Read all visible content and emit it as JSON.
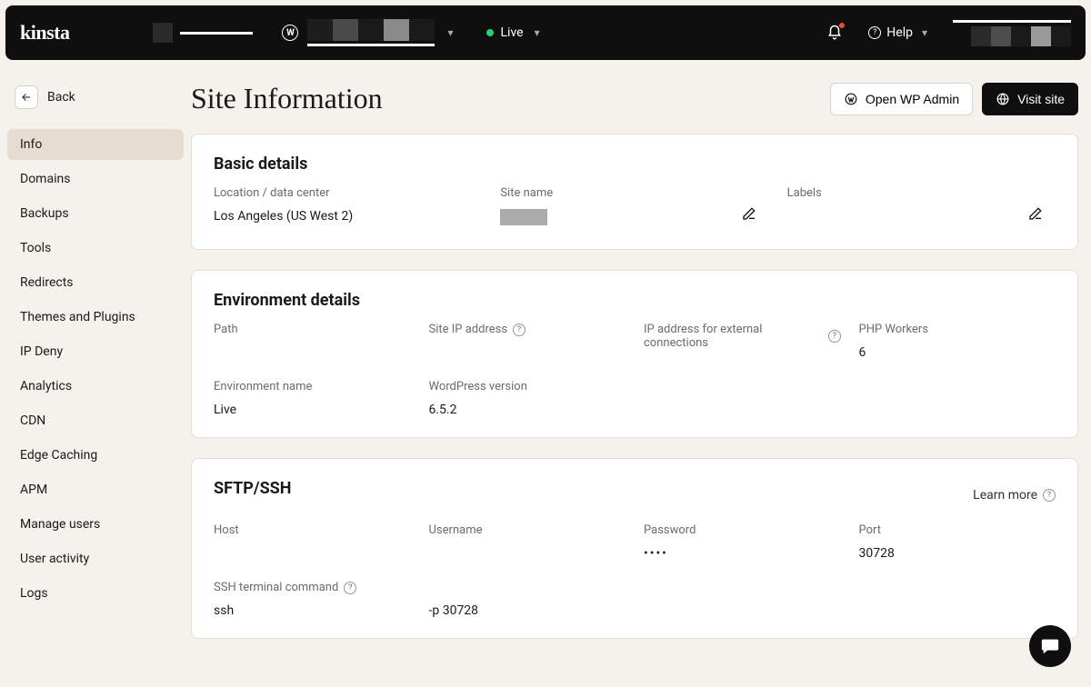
{
  "topbar": {
    "logo": "kinsta",
    "env_label": "Live",
    "help_label": "Help"
  },
  "sidebar": {
    "back_label": "Back",
    "items": [
      "Info",
      "Domains",
      "Backups",
      "Tools",
      "Redirects",
      "Themes and Plugins",
      "IP Deny",
      "Analytics",
      "CDN",
      "Edge Caching",
      "APM",
      "Manage users",
      "User activity",
      "Logs"
    ],
    "active_index": 0
  },
  "header": {
    "title": "Site Information",
    "open_wp_admin": "Open WP Admin",
    "visit_site": "Visit site"
  },
  "basic": {
    "heading": "Basic details",
    "location_label": "Location / data center",
    "location_value": "Los Angeles (US West 2)",
    "site_name_label": "Site name",
    "labels_label": "Labels"
  },
  "env": {
    "heading": "Environment details",
    "path_label": "Path",
    "site_ip_label": "Site IP address",
    "ext_ip_label": "IP address for external connections",
    "php_workers_label": "PHP Workers",
    "php_workers_value": "6",
    "env_name_label": "Environment name",
    "env_name_value": "Live",
    "wp_version_label": "WordPress version",
    "wp_version_value": "6.5.2"
  },
  "sftp": {
    "heading": "SFTP/SSH",
    "learn_more": "Learn more",
    "host_label": "Host",
    "username_label": "Username",
    "password_label": "Password",
    "password_display": "••••",
    "port_label": "Port",
    "port_value": "30728",
    "ssh_cmd_label": "SSH terminal command",
    "ssh_cmd_prefix": "ssh",
    "ssh_cmd_suffix": "-p 30728"
  }
}
